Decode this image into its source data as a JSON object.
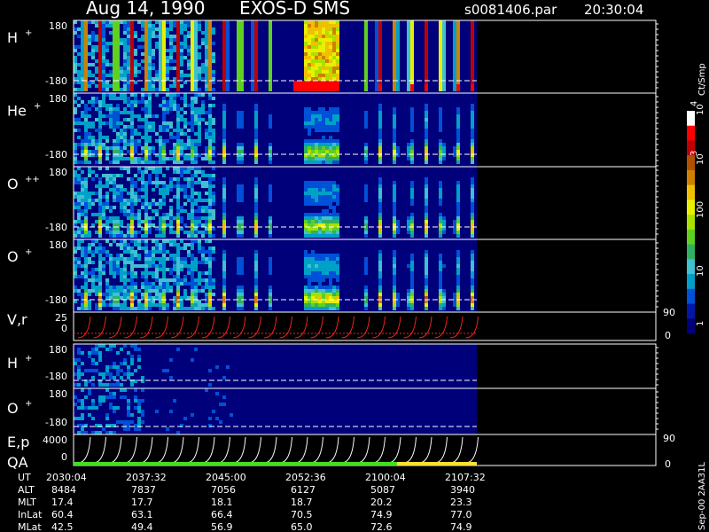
{
  "header": {
    "date": "Aug 14, 1990",
    "instrument": "EXOS-D SMS",
    "file": "s0081406.par",
    "time": "20:30:04"
  },
  "colorbar": {
    "units_label": "Ct/Smp",
    "tick_labels": [
      "1",
      "10",
      "100",
      "10",
      "10"
    ],
    "tick_sups": [
      "",
      "",
      "",
      "3",
      "4"
    ],
    "colors": [
      "#00007a",
      "#0018a8",
      "#0050d8",
      "#00a0c8",
      "#40c0d0",
      "#30b060",
      "#60d020",
      "#a8e000",
      "#e8f000",
      "#f0c000",
      "#d08000",
      "#b05000",
      "#c00000",
      "#ff0000",
      "#ffffff"
    ]
  },
  "side_label": "Sep-00  2AA31L",
  "panels": [
    {
      "name": "H",
      "sup": "+",
      "ytop": "180",
      "ybot": "-180"
    },
    {
      "name": "He",
      "sup": "+",
      "ytop": "180",
      "ybot": "-180"
    },
    {
      "name": "O",
      "sup": "++",
      "ytop": "180",
      "ybot": "-180"
    },
    {
      "name": "O",
      "sup": "+",
      "ytop": "180",
      "ybot": "-180"
    },
    {
      "name": "V,r",
      "sup": "",
      "ytop": "25",
      "ybot": "0",
      "rtop": "90",
      "rbot": "0"
    },
    {
      "name": "H",
      "sup": "+",
      "ytop": "180",
      "ybot": "-180"
    },
    {
      "name": "O",
      "sup": "+",
      "ytop": "180",
      "ybot": "-180"
    },
    {
      "name": "E,p",
      "sup": "",
      "ytop": "4000",
      "ybot": "0",
      "rtop": "90",
      "rbot": "0",
      "name2": "QA"
    }
  ],
  "ephemeris": {
    "labels": [
      "UT",
      "ALT",
      "MLT",
      "InLat",
      "MLat"
    ],
    "columns": [
      {
        "UT": "2030:04",
        "ALT": "8484",
        "MLT": "17.4",
        "InLat": "60.4",
        "MLat": "42.5"
      },
      {
        "UT": "2037:32",
        "ALT": "7837",
        "MLT": "17.7",
        "InLat": "63.1",
        "MLat": "49.4"
      },
      {
        "UT": "2045:00",
        "ALT": "7056",
        "MLT": "18.1",
        "InLat": "66.4",
        "MLat": "56.9"
      },
      {
        "UT": "2052:36",
        "ALT": "6127",
        "MLT": "18.7",
        "InLat": "70.5",
        "MLat": "65.0"
      },
      {
        "UT": "2100:04",
        "ALT": "5087",
        "MLT": "20.2",
        "InLat": "74.9",
        "MLat": "72.6"
      },
      {
        "UT": "2107:32",
        "ALT": "3940",
        "MLT": "23.3",
        "InLat": "77.0",
        "MLat": "74.9"
      }
    ]
  },
  "chart_data": {
    "type": "heatmap",
    "title": "Aug 14, 1990   EXOS-D SMS",
    "x": [
      "2030:04",
      "2037:32",
      "2045:00",
      "2052:36",
      "2100:04",
      "2107:32"
    ],
    "pitch_angle_range": [
      -180,
      180
    ],
    "colorscale": "log",
    "colorscale_ticks": [
      "1",
      "10",
      "100",
      "10^3",
      "10^4"
    ],
    "series": [
      {
        "name": "H+",
        "ylim": [
          -180,
          180
        ]
      },
      {
        "name": "He+",
        "ylim": [
          -180,
          180
        ]
      },
      {
        "name": "O++",
        "ylim": [
          -180,
          180
        ]
      },
      {
        "name": "O+",
        "ylim": [
          -180,
          180
        ]
      },
      {
        "name": "V,r",
        "ylim": [
          0,
          25
        ],
        "right_ylim": [
          0,
          90
        ]
      },
      {
        "name": "H+",
        "ylim": [
          -180,
          180
        ]
      },
      {
        "name": "O+",
        "ylim": [
          -180,
          180
        ]
      },
      {
        "name": "E,p",
        "ylim": [
          0,
          4000
        ],
        "right_ylim": [
          0,
          90
        ]
      }
    ]
  }
}
